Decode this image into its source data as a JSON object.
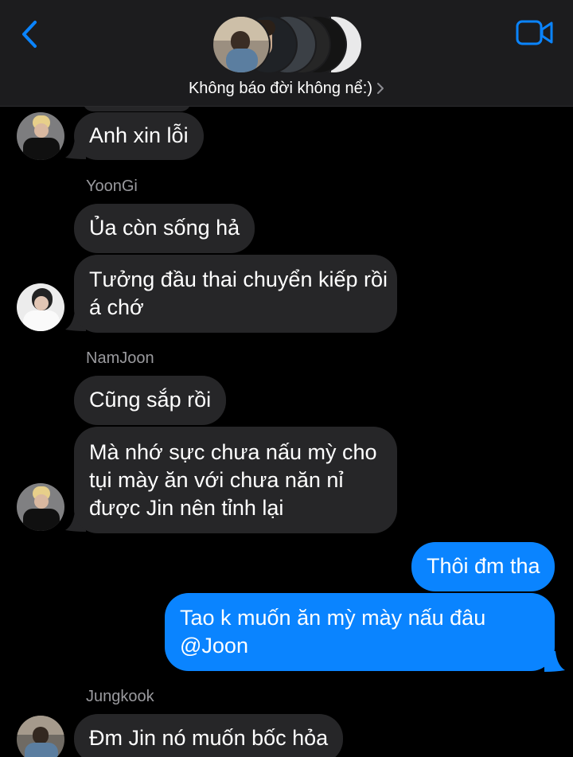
{
  "header": {
    "group_name": "Không báo đời không nể:)",
    "back_icon": "chevron-left-icon",
    "video_icon": "video-camera-icon",
    "accent_color": "#0a84ff"
  },
  "messages": [
    {
      "sender": "",
      "text": "Anh xin lỗi"
    },
    {
      "sender": "YoonGi",
      "text": "Ủa còn sống hả"
    },
    {
      "sender": "",
      "lines": [
        "Tưởng đầu thai chuyển kiếp rồi",
        "á chớ"
      ]
    },
    {
      "sender": "NamJoon",
      "text": "Cũng sắp rồi"
    },
    {
      "sender": "",
      "lines": [
        "Mà nhớ sực chưa nấu mỳ cho",
        "tụi mày ăn với chưa năn nỉ",
        "được Jin nên tỉnh lại"
      ]
    },
    {
      "sender": "me",
      "text": "Thôi đm tha"
    },
    {
      "sender": "me",
      "lines": [
        "Tao k muốn ăn mỳ mày nấu đâu",
        "@Joon"
      ]
    },
    {
      "sender": "Jungkook",
      "text": "Đm Jin nó muốn bốc hỏa"
    }
  ],
  "colors": {
    "incoming_bubble": "#262628",
    "outgoing_bubble": "#0a84ff",
    "sender_label": "#9a9a9e",
    "header_bg": "#1c1c1e"
  }
}
